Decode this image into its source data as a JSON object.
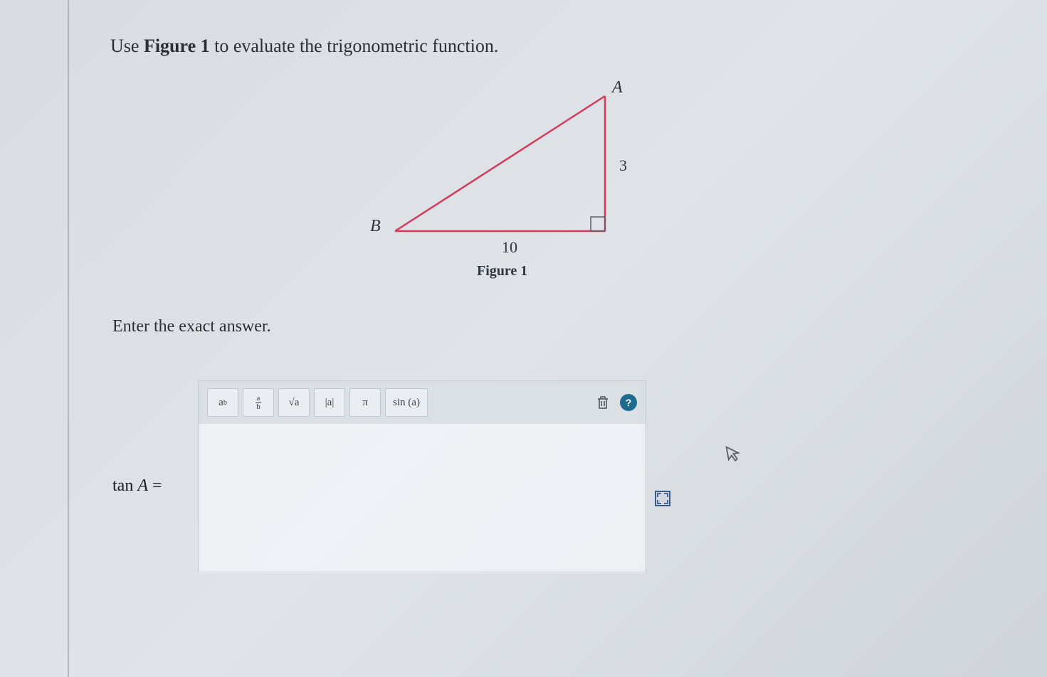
{
  "question": {
    "prefix": "Use ",
    "figure_ref": "Figure 1",
    "suffix": " to evaluate the trigonometric function."
  },
  "figure": {
    "label_B": "B",
    "label_A": "A",
    "side_vertical": "3",
    "side_horizontal": "10",
    "caption": "Figure 1"
  },
  "instruction": "Enter the exact answer.",
  "equation": {
    "func": "tan ",
    "var": "A",
    "equals": " ="
  },
  "toolbar": {
    "power": {
      "base": "a",
      "exp": "b"
    },
    "fraction": {
      "num": "a",
      "den": "b"
    },
    "sqrt": "√a",
    "abs": "|a|",
    "pi": "π",
    "sin": "sin (a)",
    "help": "?"
  }
}
